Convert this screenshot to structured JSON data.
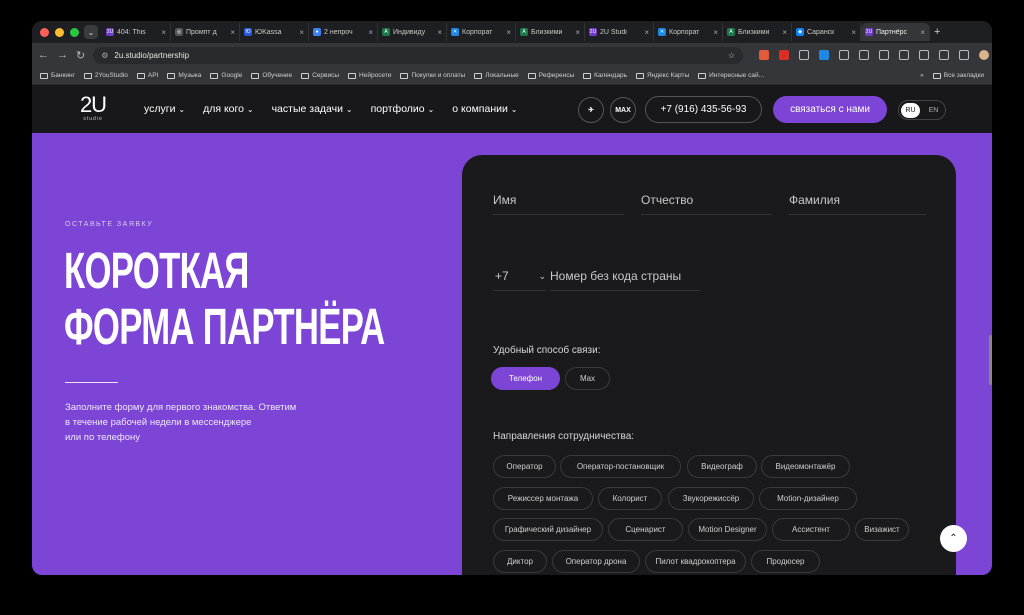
{
  "tabs": [
    {
      "title": "404: This",
      "fav": "2U",
      "color": "#6e3cc9",
      "active": false
    },
    {
      "title": "Промпт д",
      "fav": "◎",
      "color": "#555",
      "active": false
    },
    {
      "title": "ЮKassa",
      "fav": "Ю",
      "color": "#2a5bd7",
      "active": false
    },
    {
      "title": "2 непроч",
      "fav": "●",
      "color": "#3b82f6",
      "active": false
    },
    {
      "title": "Индивиду",
      "fav": "A",
      "color": "#1c7a4a",
      "active": false
    },
    {
      "title": "Корпорат",
      "fav": "✕",
      "color": "#1e88e5",
      "active": false
    },
    {
      "title": "Близкими",
      "fav": "A",
      "color": "#1c7a4a",
      "active": false
    },
    {
      "title": "2U Studi",
      "fav": "2U",
      "color": "#6e3cc9",
      "active": false
    },
    {
      "title": "Корпорат",
      "fav": "✕",
      "color": "#1e88e5",
      "active": false
    },
    {
      "title": "Близкими",
      "fav": "A",
      "color": "#1c7a4a",
      "active": false
    },
    {
      "title": "Саранск",
      "fav": "◆",
      "color": "#0a84ff",
      "active": false
    },
    {
      "title": "Партнёрс",
      "fav": "2U",
      "color": "#6e3cc9",
      "active": true
    }
  ],
  "toolbar": {
    "url": "2u.studio/partnership"
  },
  "bookmarks": [
    "Банкинг",
    "2YouStudio",
    "API",
    "Музыка",
    "Google",
    "Обучение",
    "Сервисы",
    "Нейросети",
    "Покупки и оплаты",
    "Локальные",
    "Референсы",
    "Календарь",
    "Яндекс Карты",
    "Интересные сай..."
  ],
  "bookmarks_all": "Все закладки",
  "nav": {
    "logo": "2U",
    "logo_sub": "studio",
    "menu": [
      "услуги",
      "для кого",
      "частые задачи",
      "портфолио",
      "о компании"
    ],
    "max_label": "MAX",
    "phone": "+7 (916) 435-56-93",
    "contact": "связаться с нами",
    "lang_ru": "RU",
    "lang_en": "EN"
  },
  "hero": {
    "eyebrow": "ОСТАВЬТЕ ЗАЯВКУ",
    "line1": "КОРОТКАЯ",
    "line2": "ФОРМА ПАРТНЁРА",
    "desc1": "Заполните форму для первого знакомства. Ответим",
    "desc2": "в течение рабочей недели в мессенджере",
    "desc3": "или по телефону"
  },
  "form": {
    "first_name": "Имя",
    "middle_name": "Отчество",
    "last_name": "Фамилия",
    "country_code": "+7",
    "phone_placeholder": "Номер без кода страны",
    "contact_method_label": "Удобный способ связи:",
    "contact_methods": [
      "Телефон",
      "Max"
    ],
    "directions_label": "Направления сотрудничества:",
    "directions": [
      "Оператор",
      "Оператор-постановщик",
      "Видеограф",
      "Видеомонтажёр",
      "Режиссер монтажа",
      "Колорист",
      "Звукорежиссёр",
      "Motion-дизайнер",
      "Графический дизайнер",
      "Сценарист",
      "Motion Designer",
      "Ассистент",
      "Визажист",
      "Диктор",
      "Оператор дрона",
      "Пилот квадрокоптера",
      "Продюсер"
    ]
  }
}
